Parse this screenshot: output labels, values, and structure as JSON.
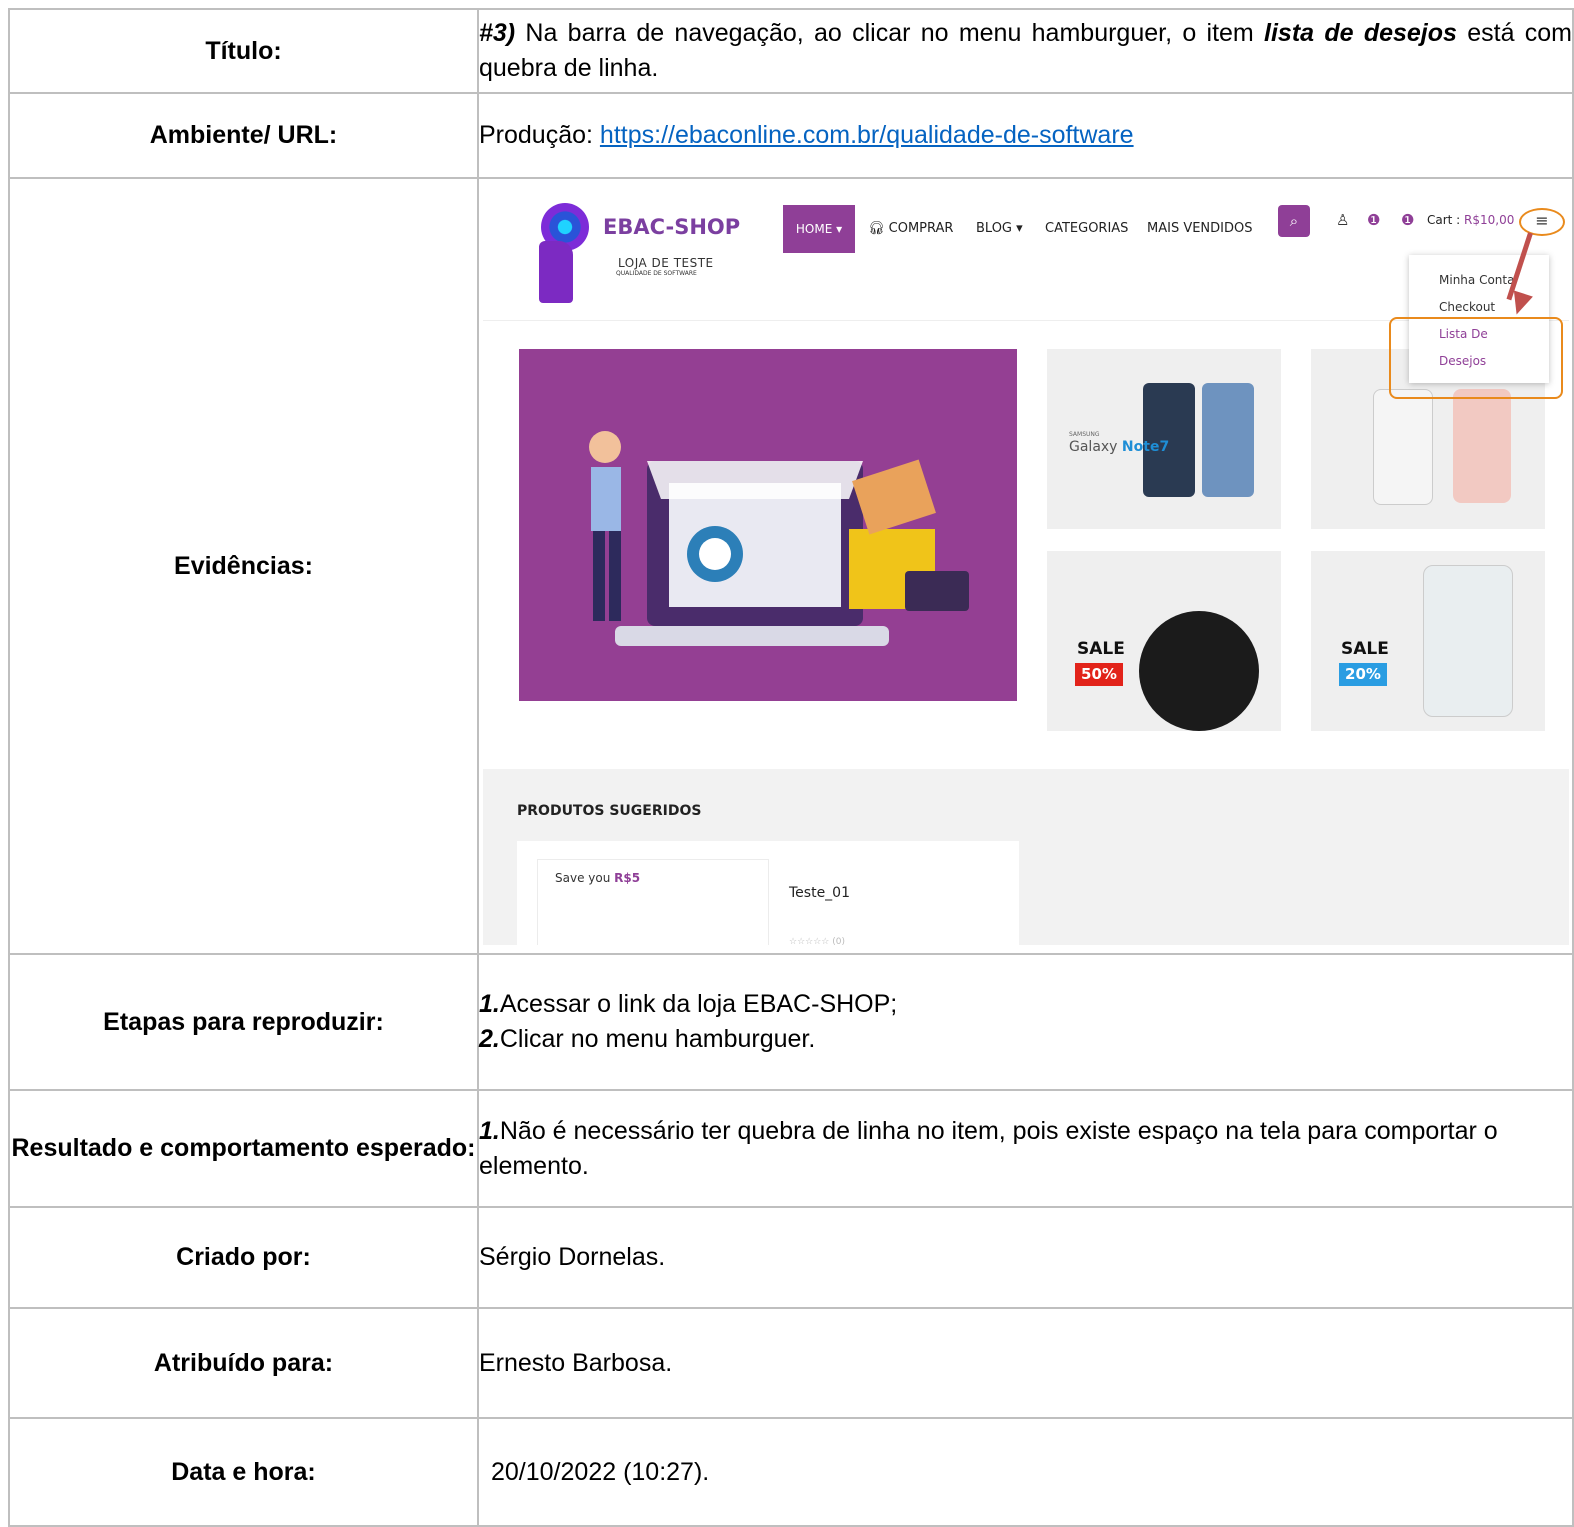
{
  "title_label": "Título:",
  "title_prefix": "#3)",
  "title_text1": " Na barra de navegação, ao clicar no menu hamburguer, o item ",
  "title_em": "lista de desejos",
  "title_text2": " está com quebra de linha.",
  "env_label": "Ambiente/ URL:",
  "env_prefix": "Produção: ",
  "env_url": "https://ebaconline.com.br/qualidade-de-software",
  "evidence_label": "Evidências:",
  "screenshot": {
    "brand": "EBAC-SHOP",
    "subtitle": "LOJA DE TESTE",
    "subtitle_small": "QUALIDADE DE SOFTWARE",
    "nav": [
      "HOME ▾",
      "COMPRAR",
      "BLOG ▾",
      "CATEGORIAS",
      "MAIS VENDIDOS"
    ],
    "cart_label": "Cart : ",
    "cart_value": "R$10,00",
    "dropdown": [
      "Minha Conta",
      "Checkout",
      "Lista De",
      "Desejos"
    ],
    "tiles": {
      "galaxy": "Galaxy",
      "galaxy_model": "Note7",
      "galaxy_brand": "SAMSUNG",
      "sale1": "SALE",
      "pct1": "50%",
      "sale2": "SALE",
      "pct2": "20%"
    },
    "suggested_title": "PRODUTOS SUGERIDOS",
    "save_text": "Save you ",
    "save_value": "R$5",
    "product_title": "Teste_01",
    "rating": "☆☆☆☆☆ (0)",
    "accent": "#8f3f97",
    "highlight": "#e98a1c",
    "arrow": "#c0504d"
  },
  "steps_label": "Etapas para reproduzir:",
  "steps": [
    {
      "num": "1.",
      "text": "Acessar o link da loja EBAC-SHOP;"
    },
    {
      "num": "2.",
      "text": "Clicar no menu hamburguer."
    }
  ],
  "expected_label": "Resultado e comportamento esperado:",
  "expected_num": "1.",
  "expected_text": "Não é necessário ter quebra de linha no item, pois existe espaço na tela para comportar o elemento.",
  "created_label": "Criado por:",
  "created_value": "Sérgio Dornelas.",
  "assigned_label": "Atribuído para:",
  "assigned_value": "Ernesto Barbosa.",
  "date_label": "Data e hora:",
  "date_value": "20/10/2022 (10:27)."
}
